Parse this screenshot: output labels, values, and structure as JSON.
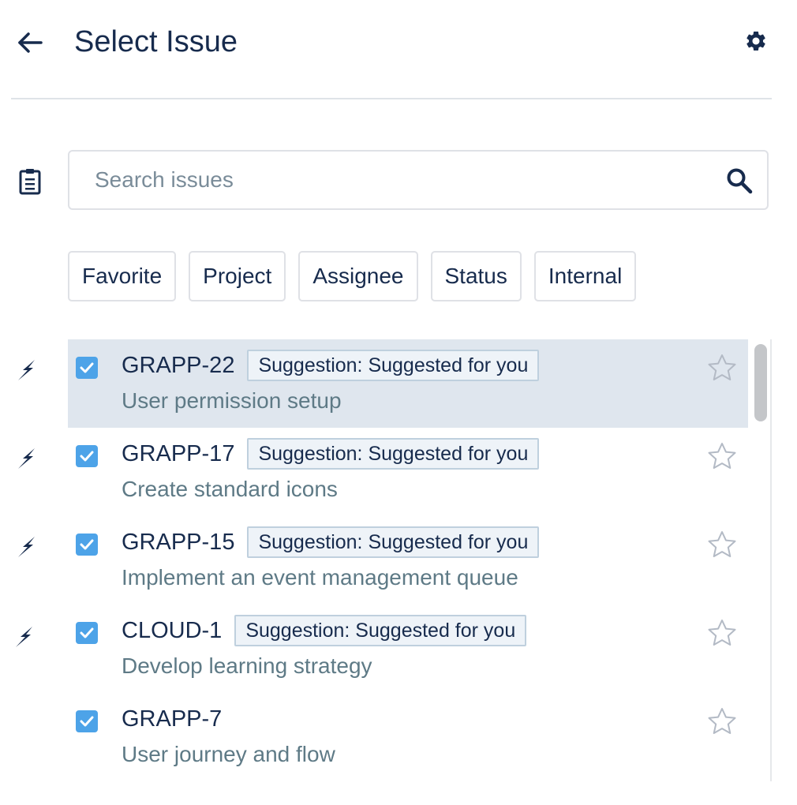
{
  "header": {
    "title": "Select Issue",
    "back_icon": "arrow-left-icon",
    "settings_icon": "gear-icon"
  },
  "search": {
    "placeholder": "Search issues",
    "value": ""
  },
  "filters": [
    "Favorite",
    "Project",
    "Assignee",
    "Status",
    "Internal"
  ],
  "issues": [
    {
      "key": "GRAPP-22",
      "badge": "Suggestion: Suggested for you",
      "summary": "User permission setup",
      "checked": true,
      "suggested": true,
      "selected": true
    },
    {
      "key": "GRAPP-17",
      "badge": "Suggestion: Suggested for you",
      "summary": "Create standard icons",
      "checked": true,
      "suggested": true,
      "selected": false
    },
    {
      "key": "GRAPP-15",
      "badge": "Suggestion: Suggested for you",
      "summary": "Implement an event management queue",
      "checked": true,
      "suggested": true,
      "selected": false
    },
    {
      "key": "CLOUD-1",
      "badge": "Suggestion: Suggested for you",
      "summary": "Develop learning strategy",
      "checked": true,
      "suggested": true,
      "selected": false
    },
    {
      "key": "GRAPP-7",
      "badge": "",
      "summary": "User journey and flow",
      "checked": true,
      "suggested": false,
      "selected": false
    }
  ],
  "colors": {
    "text_primary": "#172b4d",
    "text_secondary": "#5e7a86",
    "checkbox": "#4da3e8",
    "selected_row": "#dfe6ee"
  }
}
